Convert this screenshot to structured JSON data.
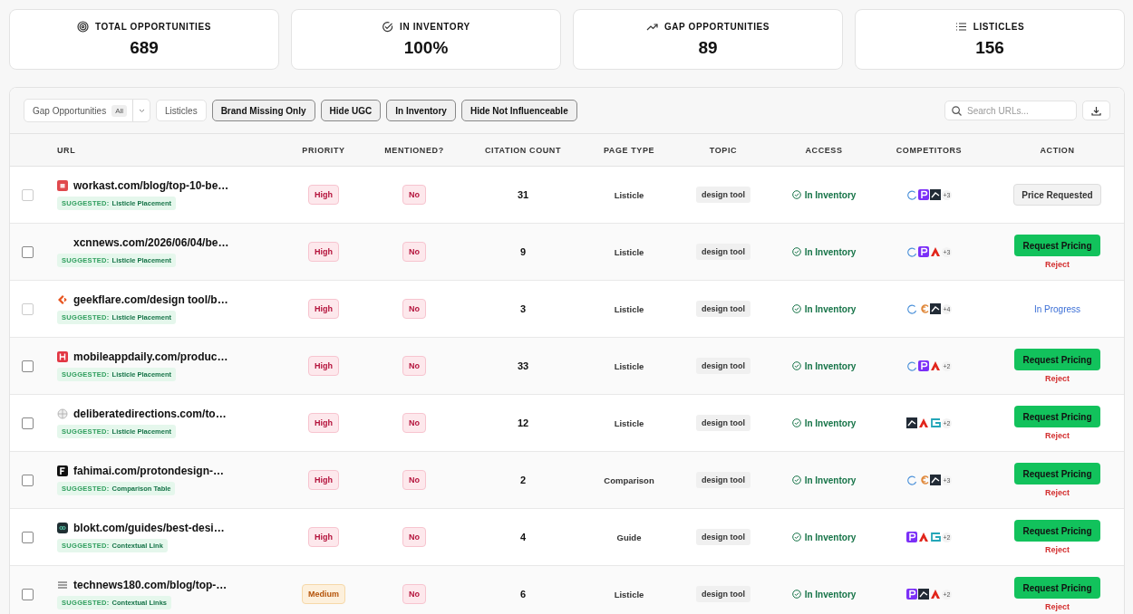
{
  "stats": [
    {
      "label": "TOTAL OPPORTUNITIES",
      "value": "689"
    },
    {
      "label": "IN INVENTORY",
      "value": "100%"
    },
    {
      "label": "GAP OPPORTUNITIES",
      "value": "89"
    },
    {
      "label": "LISTICLES",
      "value": "156"
    }
  ],
  "toolbar": {
    "dropdown": {
      "label": "Gap Opportunities",
      "badge": "All"
    },
    "filters": [
      {
        "label": "Listicles",
        "selected": false
      },
      {
        "label": "Brand Missing Only",
        "selected": true
      },
      {
        "label": "Hide UGC",
        "selected": true
      },
      {
        "label": "In Inventory",
        "selected": true
      },
      {
        "label": "Hide Not Influenceable",
        "selected": true
      }
    ],
    "search": {
      "placeholder": "Search URLs..."
    }
  },
  "table": {
    "columns": [
      "URL",
      "PRIORITY",
      "MENTIONED?",
      "CITATION COUNT",
      "PAGE TYPE",
      "TOPIC",
      "ACCESS",
      "COMPETITORS",
      "ACTION"
    ],
    "rows": [
      {
        "disabled": true,
        "url": "workast.com/blog/top-10-be…",
        "suggested_label": "SUGGESTED:",
        "suggested": "Listicle Placement",
        "priority": {
          "kind": "high",
          "text": "High"
        },
        "mentioned": "No",
        "citations": "31",
        "page_type": "Listicle",
        "topic": "design tool",
        "access": "In Inventory",
        "competitors": [
          {
            "kind": "ring"
          },
          {
            "kind": "purple"
          },
          {
            "kind": "dark"
          }
        ],
        "more": "+3",
        "action": {
          "kind": "requested",
          "label": "Price Requested"
        }
      },
      {
        "disabled": false,
        "url": "xcnnews.com/2026/06/04/be…",
        "suggested_label": "SUGGESTED:",
        "suggested": "Listicle Placement",
        "priority": {
          "kind": "high",
          "text": "High"
        },
        "mentioned": "No",
        "citations": "9",
        "page_type": "Listicle",
        "topic": "design tool",
        "access": "In Inventory",
        "competitors": [
          {
            "kind": "ring"
          },
          {
            "kind": "purple"
          },
          {
            "kind": "red"
          }
        ],
        "more": "+3",
        "action": {
          "kind": "request",
          "label": "Request Pricing",
          "secondary": "Reject"
        }
      },
      {
        "disabled": true,
        "url": "geekflare.com/design tool/b…",
        "suggested_label": "SUGGESTED:",
        "suggested": "Listicle Placement",
        "priority": {
          "kind": "high",
          "text": "High"
        },
        "mentioned": "No",
        "citations": "3",
        "page_type": "Listicle",
        "topic": "design tool",
        "access": "In Inventory",
        "competitors": [
          {
            "kind": "ring"
          },
          {
            "kind": "orange"
          },
          {
            "kind": "dark"
          }
        ],
        "more": "+4",
        "action": {
          "kind": "progress",
          "label": "In Progress"
        }
      },
      {
        "disabled": false,
        "url": "mobileappdaily.com/produc…",
        "suggested_label": "SUGGESTED:",
        "suggested": "Listicle Placement",
        "priority": {
          "kind": "high",
          "text": "High"
        },
        "mentioned": "No",
        "citations": "33",
        "page_type": "Listicle",
        "topic": "design tool",
        "access": "In Inventory",
        "competitors": [
          {
            "kind": "ring"
          },
          {
            "kind": "purple"
          },
          {
            "kind": "red"
          }
        ],
        "more": "+2",
        "action": {
          "kind": "request",
          "label": "Request Pricing",
          "secondary": "Reject"
        }
      },
      {
        "disabled": false,
        "url": "deliberatedirections.com/to…",
        "suggested_label": "SUGGESTED:",
        "suggested": "Listicle Placement",
        "priority": {
          "kind": "high",
          "text": "High"
        },
        "mentioned": "No",
        "citations": "12",
        "page_type": "Listicle",
        "topic": "design tool",
        "access": "In Inventory",
        "competitors": [
          {
            "kind": "dark"
          },
          {
            "kind": "red"
          },
          {
            "kind": "teal"
          }
        ],
        "more": "+2",
        "action": {
          "kind": "request",
          "label": "Request Pricing",
          "secondary": "Reject"
        }
      },
      {
        "disabled": false,
        "url": "fahimai.com/protondesign-…",
        "suggested_label": "SUGGESTED:",
        "suggested": "Comparison Table",
        "priority": {
          "kind": "high",
          "text": "High"
        },
        "mentioned": "No",
        "citations": "2",
        "page_type": "Comparison",
        "topic": "design tool",
        "access": "In Inventory",
        "competitors": [
          {
            "kind": "ring"
          },
          {
            "kind": "orange"
          },
          {
            "kind": "dark"
          }
        ],
        "more": "+3",
        "action": {
          "kind": "request",
          "label": "Request Pricing",
          "secondary": "Reject"
        }
      },
      {
        "disabled": false,
        "url": "blokt.com/guides/best-desi…",
        "suggested_label": "SUGGESTED:",
        "suggested": "Contextual Link",
        "priority": {
          "kind": "high",
          "text": "High"
        },
        "mentioned": "No",
        "citations": "4",
        "page_type": "Guide",
        "topic": "design tool",
        "access": "In Inventory",
        "competitors": [
          {
            "kind": "purple"
          },
          {
            "kind": "red"
          },
          {
            "kind": "teal"
          }
        ],
        "more": "+2",
        "action": {
          "kind": "request",
          "label": "Request Pricing",
          "secondary": "Reject"
        }
      },
      {
        "disabled": false,
        "url": "technews180.com/blog/top-…",
        "suggested_label": "SUGGESTED:",
        "suggested": "Contextual Links",
        "priority": {
          "kind": "medium",
          "text": "Medium"
        },
        "mentioned": "No",
        "citations": "6",
        "page_type": "Listicle",
        "topic": "design tool",
        "access": "In Inventory",
        "competitors": [
          {
            "kind": "purple"
          },
          {
            "kind": "dark"
          },
          {
            "kind": "red"
          }
        ],
        "more": "+2",
        "action": {
          "kind": "request",
          "label": "Request Pricing",
          "secondary": "Reject"
        }
      }
    ]
  }
}
